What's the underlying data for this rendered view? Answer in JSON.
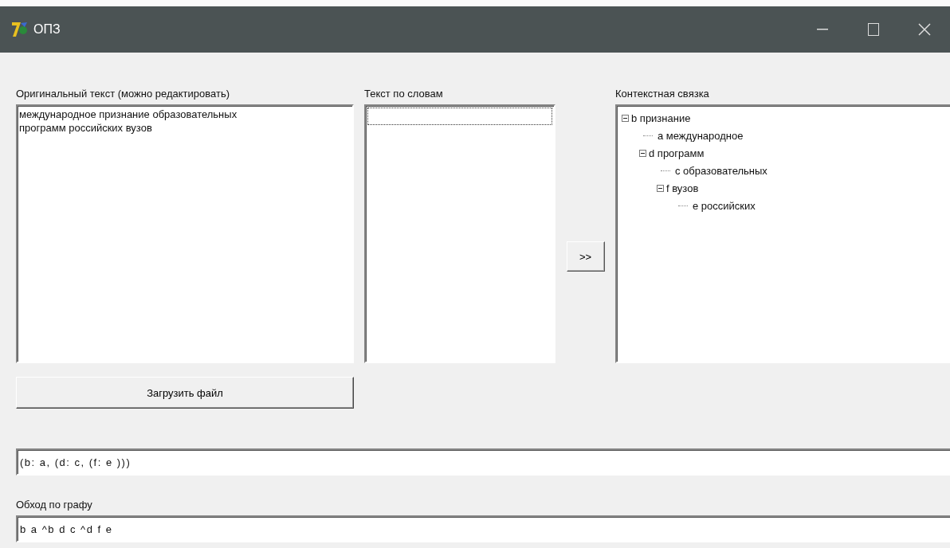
{
  "window": {
    "title": "ОПЗ"
  },
  "original_text": {
    "label": "Оригинальный текст (можно редактировать)",
    "value": "международное признание образовательных\nпрограмм российских вузов"
  },
  "words": {
    "label": "Текст по словам"
  },
  "transfer_button": {
    "label": ">>"
  },
  "context": {
    "label": "Контекстная связка",
    "tree": [
      {
        "label": "b признание",
        "expanded": true,
        "children": [
          {
            "label": "a международное"
          },
          {
            "label": "d программ",
            "expanded": true,
            "children": [
              {
                "label": "c образовательных"
              },
              {
                "label": "f вузов",
                "expanded": true,
                "children": [
                  {
                    "label": "e российских"
                  }
                ]
              }
            ]
          }
        ]
      }
    ]
  },
  "load_button": {
    "label": "Загрузить файл"
  },
  "structure_field": {
    "value": "(b: a, (d: c, (f: e )))"
  },
  "traversal": {
    "label": "Обход по графу",
    "value": "b a ^b d c ^d f e"
  }
}
